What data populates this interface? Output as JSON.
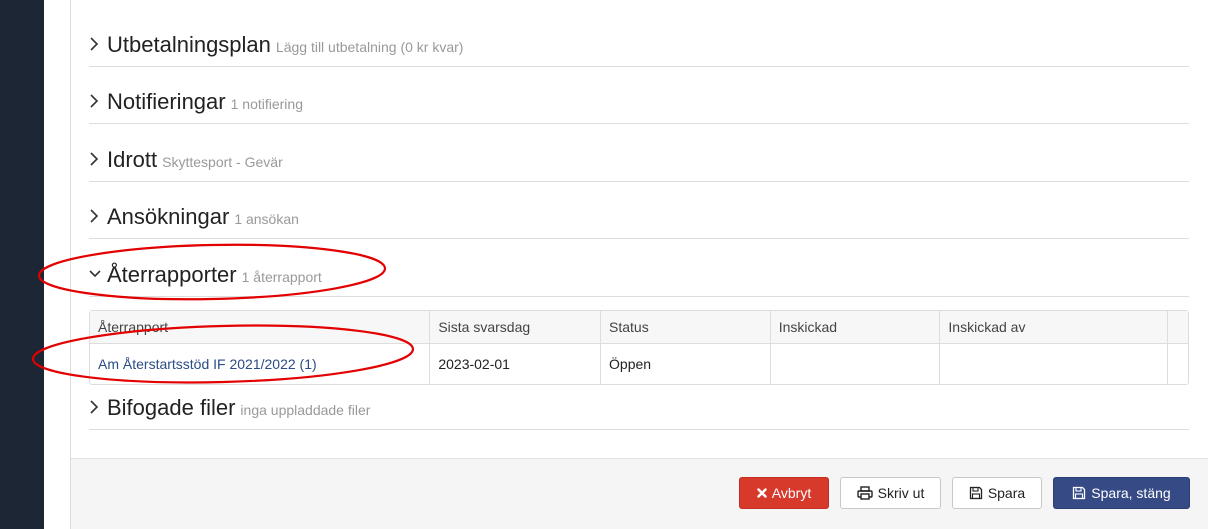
{
  "sections": [
    {
      "title": "Utbetalningsplan",
      "subtitle": "Lägg till utbetalning (0 kr kvar)",
      "expanded": false
    },
    {
      "title": "Notifieringar",
      "subtitle": "1 notifiering",
      "expanded": false
    },
    {
      "title": "Idrott",
      "subtitle": "Skyttesport - Gevär",
      "expanded": false
    },
    {
      "title": "Ansökningar",
      "subtitle": "1 ansökan",
      "expanded": false
    },
    {
      "title": "Återrapporter",
      "subtitle": "1 återrapport",
      "expanded": true
    },
    {
      "title": "Bifogade filer",
      "subtitle": "inga uppladdade filer",
      "expanded": false
    }
  ],
  "reports_table": {
    "headers": [
      "Återrapport",
      "Sista svarsdag",
      "Status",
      "Inskickad",
      "Inskickad av"
    ],
    "rows": [
      [
        "Am Återstartsstöd IF 2021/2022 (1)",
        "2023-02-01",
        "Öppen",
        "",
        ""
      ]
    ]
  },
  "footer": {
    "cancel_label": "Avbryt",
    "print_label": "Skriv ut",
    "save_label": "Spara",
    "save_close_label": "Spara, stäng"
  },
  "colors": {
    "sidebar": "#1d2634",
    "cancel": "#d7392b",
    "primary": "#364a86",
    "link": "#2b4c86",
    "annotation": "#e30000"
  }
}
